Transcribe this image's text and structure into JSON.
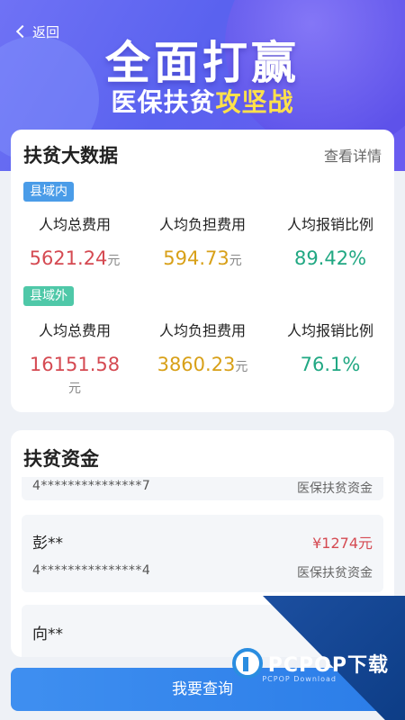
{
  "header": {
    "back_label": "返回",
    "title": "全面打赢",
    "subtitle_prefix": "医保扶贫",
    "subtitle_highlight": "攻坚战"
  },
  "big_data": {
    "title": "扶贫大数据",
    "detail_link": "查看详情",
    "in_county": {
      "tag": "县域内",
      "metrics": [
        {
          "label": "人均总费用",
          "value": "5621.24",
          "unit": "元"
        },
        {
          "label": "人均负担费用",
          "value": "594.73",
          "unit": "元"
        },
        {
          "label": "人均报销比例",
          "value": "89.42%",
          "unit": ""
        }
      ]
    },
    "out_county": {
      "tag": "县域外",
      "metrics": [
        {
          "label": "人均总费用",
          "value": "16151.58",
          "unit": "元"
        },
        {
          "label": "人均负担费用",
          "value": "3860.23",
          "unit": "元"
        },
        {
          "label": "人均报销比例",
          "value": "76.1%",
          "unit": ""
        }
      ]
    }
  },
  "funds": {
    "title": "扶贫资金",
    "items": [
      {
        "name": "",
        "amount": "",
        "id": "4***************7",
        "type": "医保扶贫资金"
      },
      {
        "name": "彭**",
        "amount": "¥1274元",
        "id": "4***************4",
        "type": "医保扶贫资金"
      },
      {
        "name": "向**",
        "amount": "",
        "id": "",
        "type": ""
      }
    ]
  },
  "query_button": "我要查询",
  "watermark": {
    "brand": "PCPOP",
    "cn": "下载",
    "sub": "PCPOP Download"
  },
  "colors": {
    "accent": "#3f8ff0",
    "red": "#d54a52",
    "gold": "#d8a018",
    "green": "#21a883"
  }
}
